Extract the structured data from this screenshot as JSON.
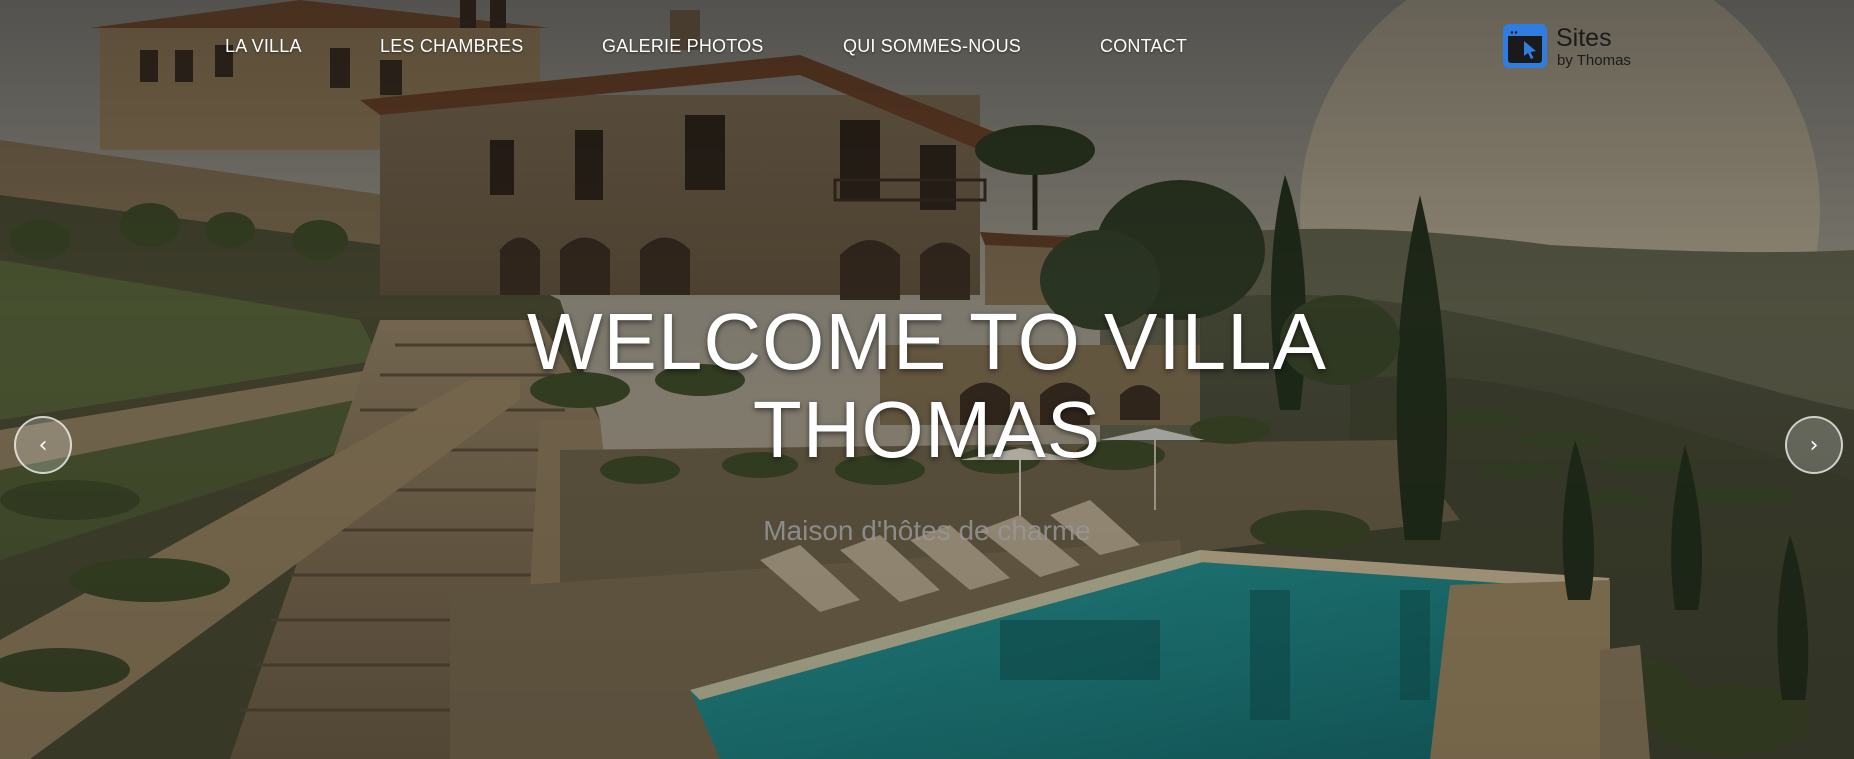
{
  "nav": {
    "items": [
      {
        "label": "LA VILLA"
      },
      {
        "label": "LES CHAMBRES"
      },
      {
        "label": "GALERIE PHOTOS"
      },
      {
        "label": "QUI SOMMES-NOUS"
      },
      {
        "label": "CONTACT"
      }
    ]
  },
  "logo": {
    "title": "Sites",
    "subtitle": "by Thomas",
    "icon": "browser-cursor-icon",
    "accent_color": "#2f7de1"
  },
  "hero": {
    "headline": "WELCOME TO VILLA THOMAS",
    "subtitle": "Maison d'hôtes de charme",
    "image": "tuscan-villa-pool-sunset"
  },
  "carousel": {
    "prev_label": "‹",
    "next_label": "›"
  }
}
